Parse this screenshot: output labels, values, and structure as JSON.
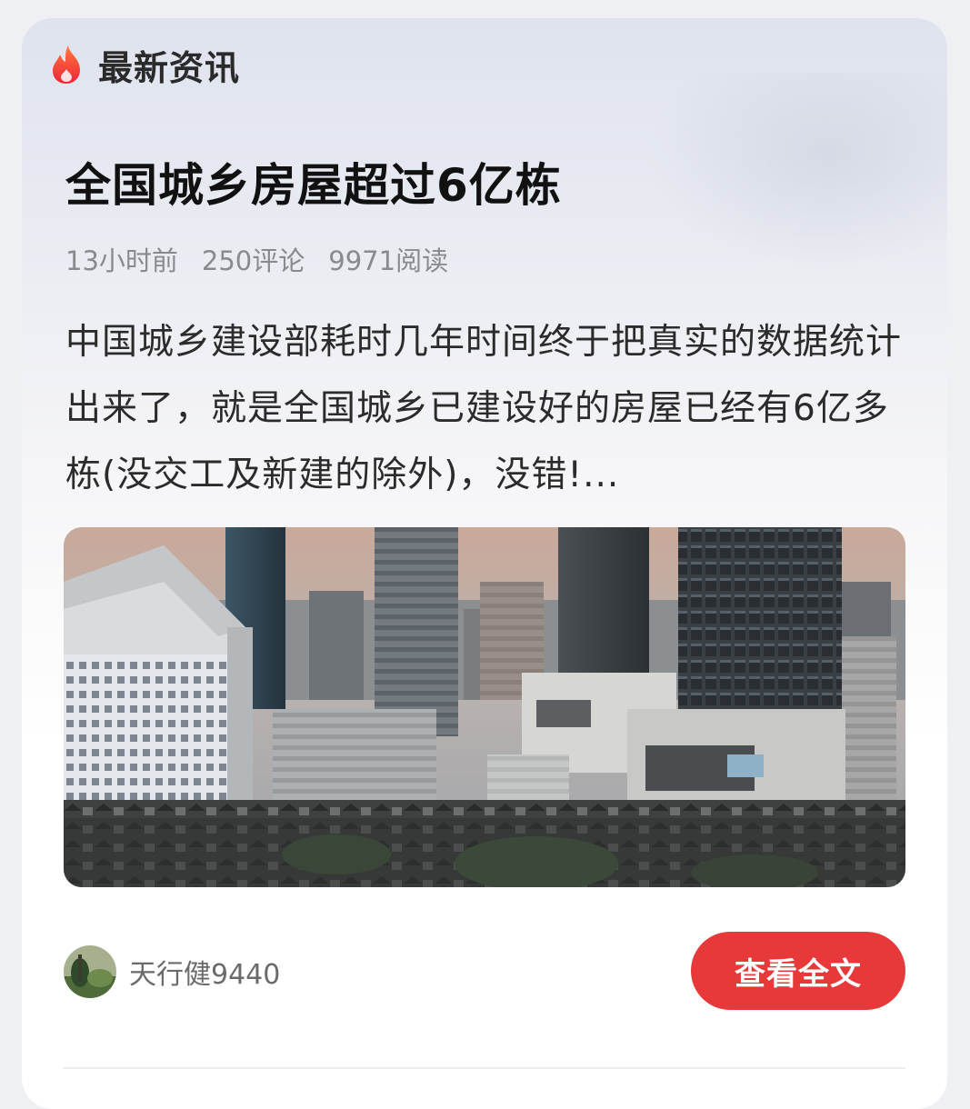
{
  "section": {
    "title": "最新资讯",
    "icon": "fire-icon"
  },
  "article": {
    "title": "全国城乡房屋超过6亿栋",
    "meta": {
      "time": "13小时前",
      "comments": "250评论",
      "reads": "9971阅读"
    },
    "summary": "中国城乡建设部耗时几年时间终于把真实的数据统计出来了，就是全国城乡已建设好的房屋已经有6亿多栋(没交工及新建的除外)，没错!...",
    "image": "city-skyline-photo"
  },
  "author": {
    "name": "天行健9440",
    "avatar": "avatar"
  },
  "actions": {
    "read_full": "查看全文"
  },
  "colors": {
    "accent": "#e7383a",
    "fire_start": "#ff7a3d",
    "fire_end": "#f0243a"
  }
}
